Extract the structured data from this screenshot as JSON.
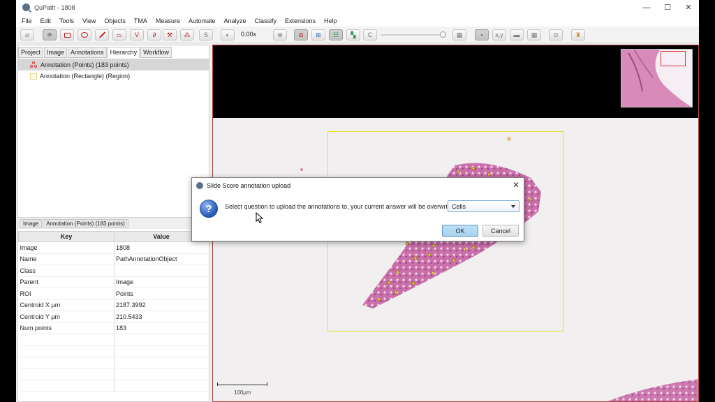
{
  "window": {
    "title": "QuPath - 1808",
    "minimize": "—",
    "maximize": "☐",
    "close": "✕"
  },
  "menu": [
    "File",
    "Edit",
    "Tools",
    "View",
    "Objects",
    "TMA",
    "Measure",
    "Automate",
    "Analyze",
    "Classify",
    "Extensions",
    "Help"
  ],
  "toolbar": {
    "zoom": "0.00x"
  },
  "tabs": [
    "Project",
    "Image",
    "Annotations",
    "Hierarchy",
    "Workflow"
  ],
  "active_tab": "Hierarchy",
  "hierarchy": [
    {
      "label": "Annotation (Points) (183 points)",
      "selected": true
    },
    {
      "label": "Annotation (Rectangle) (Region)",
      "selected": false
    }
  ],
  "breadcrumb": [
    "Image",
    "Annotation (Points) (183 points)"
  ],
  "properties": {
    "headers": [
      "Key",
      "Value"
    ],
    "rows": [
      [
        "Image",
        "1808"
      ],
      [
        "Name",
        "PathAnnotationObject"
      ],
      [
        "Class",
        ""
      ],
      [
        "Parent",
        "Image"
      ],
      [
        "ROI",
        "Points"
      ],
      [
        "Centroid X µm",
        "2187.3992"
      ],
      [
        "Centroid Y µm",
        "210.5433"
      ],
      [
        "Num points",
        "183"
      ]
    ]
  },
  "viewer": {
    "scale_label": "100µm"
  },
  "dialog": {
    "title": "Slide Score annotation upload",
    "message": "Select question to upload the annotations to, your current answer will be overwritten.",
    "selected_option": "Cells",
    "ok": "OK",
    "cancel": "Cancel"
  },
  "colors": {
    "accent": "#a8d1f0",
    "annotation": "#e9df2b",
    "tissue": "#c8609a"
  }
}
